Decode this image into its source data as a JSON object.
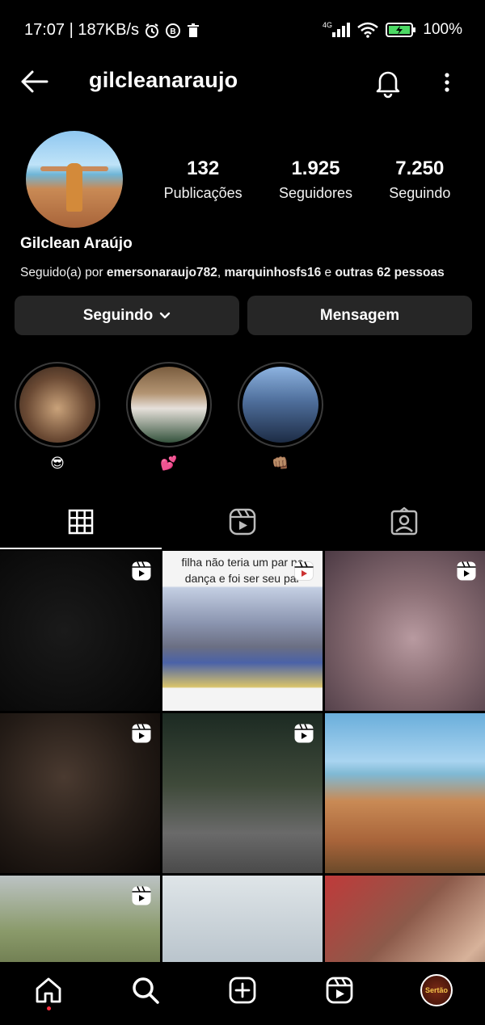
{
  "status": {
    "time_speed": "17:07 | 187KB/s",
    "network": "4G",
    "battery": "100%"
  },
  "header": {
    "username": "gilcleanaraujo"
  },
  "profile": {
    "fullname": "Gilclean Araújo",
    "stats": [
      {
        "value": "132",
        "label": "Publicações"
      },
      {
        "value": "1.925",
        "label": "Seguidores"
      },
      {
        "value": "7.250",
        "label": "Seguindo"
      }
    ],
    "followed_by": {
      "prefix": "Seguido(a) por ",
      "user1": "emersonaraujo782",
      "sep": ", ",
      "user2": "marquinhosfs16",
      "mid": " e ",
      "rest": "outras 62 pessoas"
    },
    "buttons": {
      "following": "Seguindo",
      "message": "Mensagem"
    }
  },
  "highlights": [
    {
      "label": "😎",
      "colors": [
        "#c9a27a",
        "#4a3626"
      ]
    },
    {
      "label": "💕",
      "colors": [
        "#9c7b5a",
        "#2f4d3a"
      ]
    },
    {
      "label": "👊🏽",
      "colors": [
        "#5f86c2",
        "#1d2c45"
      ]
    }
  ],
  "grid": [
    {
      "reel": true,
      "bg": "#0a0a0a",
      "caption": ""
    },
    {
      "reel": true,
      "bg": "#f4f4f4",
      "caption": "filha não teria um par na dança e foi ser seu par"
    },
    {
      "reel": true,
      "bg": "#8a6e74",
      "caption": ""
    },
    {
      "reel": true,
      "bg": "#231b16",
      "caption": ""
    },
    {
      "reel": true,
      "bg": "#3f4a3a",
      "caption": ""
    },
    {
      "reel": false,
      "bg": "#6aaedb",
      "caption": ""
    },
    {
      "reel": true,
      "bg": "#5f6b42",
      "caption": ""
    },
    {
      "reel": false,
      "bg": "#b9c4cc",
      "caption": ""
    },
    {
      "reel": false,
      "bg": "#8c5a4a",
      "caption": ""
    }
  ],
  "nav": {
    "profile_badge": "Sertão"
  }
}
